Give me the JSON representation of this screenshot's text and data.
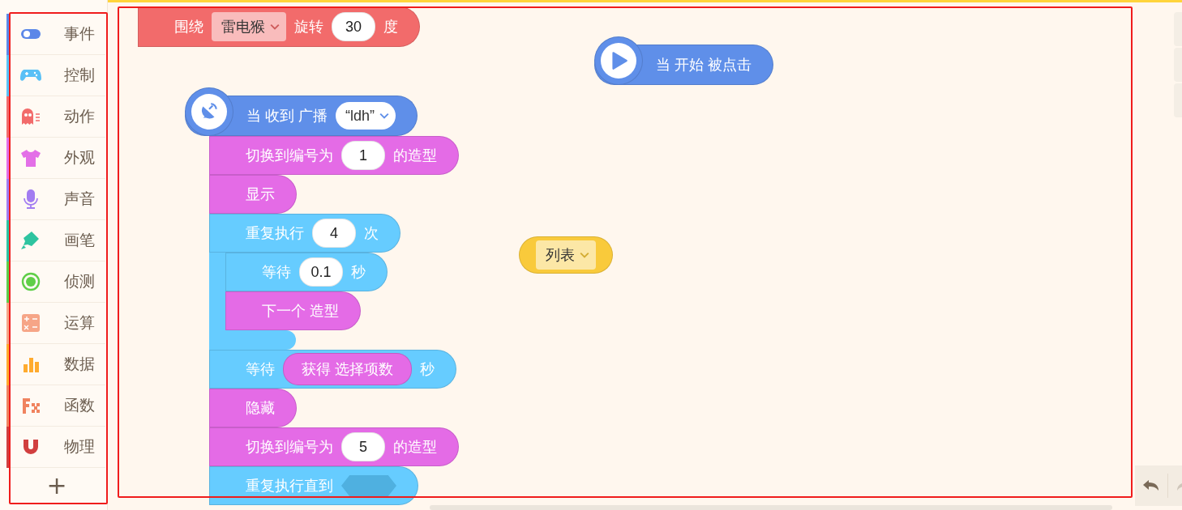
{
  "sidebar": {
    "categories": [
      {
        "label": "事件",
        "color": "#5b87e8"
      },
      {
        "label": "控制",
        "color": "#59c0f6"
      },
      {
        "label": "动作",
        "color": "#f26b6b"
      },
      {
        "label": "外观",
        "color": "#e36fe7"
      },
      {
        "label": "声音",
        "color": "#a27cf1"
      },
      {
        "label": "画笔",
        "color": "#2ec4a0"
      },
      {
        "label": "侦测",
        "color": "#5fce48"
      },
      {
        "label": "运算",
        "color": "#f6a587"
      },
      {
        "label": "数据",
        "color": "#ffab2e"
      },
      {
        "label": "函数",
        "color": "#f0835f"
      },
      {
        "label": "物理",
        "color": "#d13f3f"
      }
    ],
    "add_button": "+"
  },
  "canvas": {
    "scripts": [
      {
        "blocks": [
          {
            "kind": "stack",
            "color": "#f26b6b",
            "parts": [
              {
                "kind": "text",
                "text": "围绕"
              },
              {
                "kind": "dropdown",
                "text": "雷电猴"
              },
              {
                "kind": "text",
                "text": "旋转"
              },
              {
                "kind": "number",
                "text": "30"
              },
              {
                "kind": "text",
                "text": "度"
              }
            ]
          }
        ]
      },
      {
        "blocks": [
          {
            "kind": "hat",
            "color": "#5f8fe9",
            "parts": [
              {
                "kind": "text",
                "text": "当 开始 被点击"
              }
            ]
          }
        ]
      },
      {
        "blocks": [
          {
            "kind": "hat",
            "color": "#5f8fe9",
            "parts": [
              {
                "kind": "text",
                "text": "当 收到 广播"
              },
              {
                "kind": "dropdown",
                "text": "“ldh”"
              }
            ]
          },
          {
            "kind": "stack",
            "color": "#e46be6",
            "parts": [
              {
                "kind": "text",
                "text": "切换到编号为"
              },
              {
                "kind": "number",
                "text": "1"
              },
              {
                "kind": "text",
                "text": "的造型"
              }
            ]
          },
          {
            "kind": "stack",
            "color": "#e46be6",
            "parts": [
              {
                "kind": "text",
                "text": "显示"
              }
            ]
          },
          {
            "kind": "loop",
            "color": "#66ccff",
            "parts": [
              {
                "kind": "text",
                "text": "重复执行"
              },
              {
                "kind": "number",
                "text": "4"
              },
              {
                "kind": "text",
                "text": "次"
              }
            ],
            "children": [
              {
                "kind": "stack",
                "color": "#66ccff",
                "parts": [
                  {
                    "kind": "text",
                    "text": "等待"
                  },
                  {
                    "kind": "number",
                    "text": "0.1"
                  },
                  {
                    "kind": "text",
                    "text": "秒"
                  }
                ]
              },
              {
                "kind": "stack",
                "color": "#e46be6",
                "parts": [
                  {
                    "kind": "text",
                    "text": "下一个 造型"
                  }
                ]
              }
            ]
          },
          {
            "kind": "stack",
            "color": "#66ccff",
            "parts": [
              {
                "kind": "text",
                "text": "等待"
              },
              {
                "kind": "reporter",
                "color": "#e46be6",
                "text": "获得 选择项数"
              },
              {
                "kind": "text",
                "text": "秒"
              }
            ]
          },
          {
            "kind": "stack",
            "color": "#e46be6",
            "parts": [
              {
                "kind": "text",
                "text": "隐藏"
              }
            ]
          },
          {
            "kind": "stack",
            "color": "#e46be6",
            "parts": [
              {
                "kind": "text",
                "text": "切换到编号为"
              },
              {
                "kind": "number",
                "text": "5"
              },
              {
                "kind": "text",
                "text": "的造型"
              }
            ]
          },
          {
            "kind": "loop",
            "color": "#66ccff",
            "parts": [
              {
                "kind": "text",
                "text": "重复执行直到"
              },
              {
                "kind": "boolean"
              }
            ]
          }
        ]
      },
      {
        "blocks": [
          {
            "kind": "reporter",
            "color": "#f9ca3b",
            "parts": [
              {
                "kind": "dropdown",
                "text": "列表"
              }
            ]
          }
        ]
      }
    ]
  }
}
